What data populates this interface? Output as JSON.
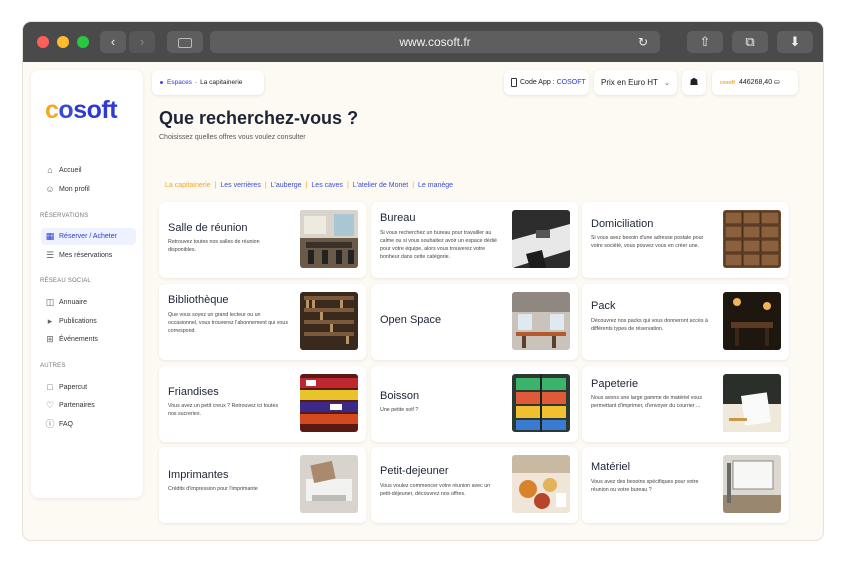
{
  "browser": {
    "url": "www.cosoft.fr",
    "back_icon": "chevron-left-icon",
    "forward_icon": "chevron-right-icon",
    "reload_icon": "reload-icon"
  },
  "sidebar": {
    "logo": {
      "a": "c",
      "b": "o",
      "rest": "soft"
    },
    "items": [
      {
        "label": "Accueil",
        "icon": "home-icon"
      },
      {
        "label": "Mon profil",
        "icon": "user-icon"
      }
    ],
    "section_reservations": "RÉSERVATIONS",
    "reservations": [
      {
        "label": "Réserver / Acheter",
        "icon": "calendar-icon"
      },
      {
        "label": "Mes réservations",
        "icon": "layers-icon"
      }
    ],
    "section_social": "RÉSEAU SOCIAL",
    "social": [
      {
        "label": "Annuaire",
        "icon": "book-icon"
      },
      {
        "label": "Publications",
        "icon": "megaphone-icon"
      },
      {
        "label": "Événements",
        "icon": "calendar-plus-icon"
      }
    ],
    "section_autres": "AUTRES",
    "autres": [
      {
        "label": "Papercut",
        "icon": "document-icon"
      },
      {
        "label": "Partenaires",
        "icon": "heart-icon"
      },
      {
        "label": "FAQ",
        "icon": "help-icon"
      }
    ]
  },
  "breadcrumb": {
    "first": "Espaces",
    "sep": "-",
    "second": "La capitainerie"
  },
  "header": {
    "code_app_label": "Code App :",
    "code_app_value": "COSOFT",
    "price_mode": "Prix en Euro HT",
    "balance": "446268,40"
  },
  "main": {
    "title": "Que recherchez-vous ?",
    "subtitle": "Choisissez quelles offres vous voulez consulter",
    "tabs": [
      "La capitainerie",
      "Les verrières",
      "L'auberge",
      "Les caves",
      "L'atelier de Monet",
      "Le manège"
    ]
  },
  "cards": [
    {
      "title": "Salle de réunion",
      "desc": "Retrouvez toutes nos salles de réunion disponibles."
    },
    {
      "title": "Bureau",
      "desc": "Si vous recherchez un bureau pour travailler au calme ou si vous souhaitez avoir un espace dédié pour votre équipe, alors vous trouverez votre bonheur dans cette catégorie."
    },
    {
      "title": "Domiciliation",
      "desc": "Si vous avez besoin d'une adresse postale pour votre société, vous pouvez vous en créer une."
    },
    {
      "title": "Bibliothèque",
      "desc": "Que vous soyez un grand lecteur ou un occasionnel, vous trouverez l'abonnement qui vous correspond."
    },
    {
      "title": "Open Space",
      "desc": ""
    },
    {
      "title": "Pack",
      "desc": "Découvrez nos packs qui vous donneront accès à différents types de réservation."
    },
    {
      "title": "Friandises",
      "desc": "Vous avez un petit creux ? Retrouvez ici toutes nos sucreries."
    },
    {
      "title": "Boisson",
      "desc": "Une petite soif ?"
    },
    {
      "title": "Papeterie",
      "desc": "Nous avons une large gamme de matériel vous permettant d'imprimer, d'envoyer du courrier ..."
    },
    {
      "title": "Imprimantes",
      "desc": "Crédits d'impression pour l'imprimante"
    },
    {
      "title": "Petit-dejeuner",
      "desc": "Vous voulez commencer votre réunion avec un petit-déjeuner, découvrez nos offres."
    },
    {
      "title": "Matériel",
      "desc": "Vous avez des besoins spécifiques pour votre réunion ou votre bureau ?"
    }
  ]
}
